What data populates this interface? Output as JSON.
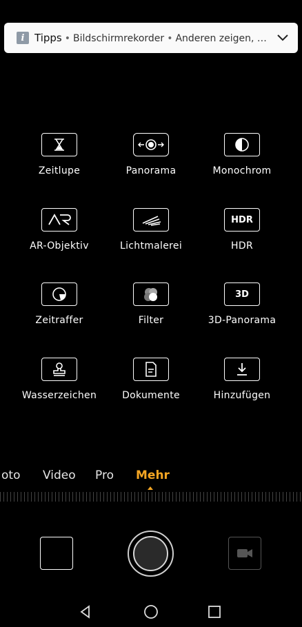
{
  "notification": {
    "app": "Tipps",
    "separator": "•",
    "text1": "Bildschirmrekorder",
    "text2": "Anderen zeigen, was..."
  },
  "modes_grid": [
    {
      "label": "Zeitlupe",
      "icon": "hourglass-icon"
    },
    {
      "label": "Panorama",
      "icon": "panorama-icon"
    },
    {
      "label": "Monochrom",
      "icon": "monochrome-icon"
    },
    {
      "label": "AR-Objektiv",
      "icon": "ar-icon",
      "icon_text": "AR"
    },
    {
      "label": "Lichtmalerei",
      "icon": "light-painting-icon"
    },
    {
      "label": "HDR",
      "icon": "hdr-icon",
      "icon_text": "HDR"
    },
    {
      "label": "Zeitraffer",
      "icon": "time-lapse-icon"
    },
    {
      "label": "Filter",
      "icon": "filter-icon"
    },
    {
      "label": "3D-Panorama",
      "icon": "3d-panorama-icon",
      "icon_text": "3D"
    },
    {
      "label": "Wasserzeichen",
      "icon": "watermark-icon"
    },
    {
      "label": "Dokumente",
      "icon": "document-icon"
    },
    {
      "label": "Hinzufügen",
      "icon": "download-icon"
    }
  ],
  "mode_strip": {
    "items": [
      "oto",
      "Video",
      "Pro",
      "Mehr"
    ],
    "active": "Mehr"
  },
  "colors": {
    "accent": "#f5a623",
    "background": "#000000"
  }
}
